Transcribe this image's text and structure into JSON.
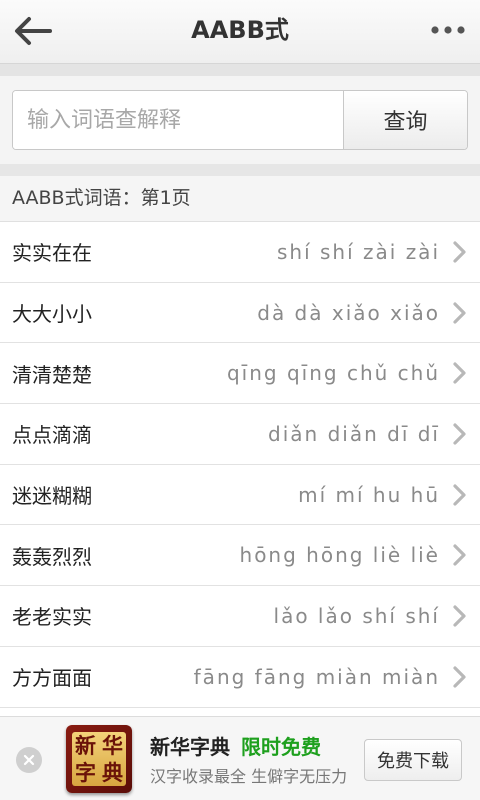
{
  "header": {
    "title": "AABB式",
    "back_icon": "arrow-left-icon",
    "more_icon": "more-dots-icon"
  },
  "search": {
    "placeholder": "输入词语查解释",
    "value": "",
    "button_label": "查询"
  },
  "section": {
    "title": "AABB式词语：第1页"
  },
  "words": [
    {
      "word": "实实在在",
      "pinyin": "shí shí zài zài"
    },
    {
      "word": "大大小小",
      "pinyin": "dà dà xiǎo xiǎo"
    },
    {
      "word": "清清楚楚",
      "pinyin": "qīng qīng chǔ chǔ"
    },
    {
      "word": "点点滴滴",
      "pinyin": "diǎn diǎn dī dī"
    },
    {
      "word": "迷迷糊糊",
      "pinyin": "mí mí hu hū"
    },
    {
      "word": "轰轰烈烈",
      "pinyin": "hōng hōng liè liè"
    },
    {
      "word": "老老实实",
      "pinyin": "lǎo lǎo shí shí"
    },
    {
      "word": "方方面面",
      "pinyin": "fāng fāng miàn miàn"
    }
  ],
  "ad": {
    "app_name": "新华字典",
    "promo": "限时免费",
    "subtitle": "汉字收录最全 生僻字无压力",
    "download_label": "免费下载",
    "logo_chars": [
      "新",
      "华",
      "字",
      "典"
    ],
    "promo_color": "#1ea01e"
  }
}
